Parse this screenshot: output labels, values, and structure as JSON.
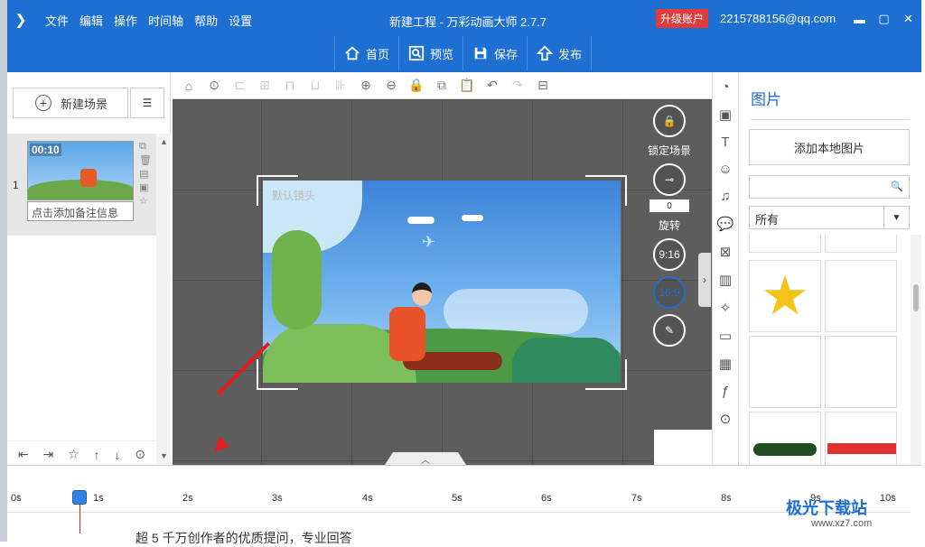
{
  "menu": [
    "文件",
    "编辑",
    "操作",
    "时间轴",
    "帮助",
    "设置"
  ],
  "window_title": "新建工程 - 万彩动画大师 2.7.7",
  "upgrade": "升级账户",
  "email": "2215788156@qq.com",
  "toolbar": [
    {
      "label": "首页",
      "icon": "home-icon"
    },
    {
      "label": "预览",
      "icon": "preview-icon"
    },
    {
      "label": "保存",
      "icon": "save-icon"
    },
    {
      "label": "发布",
      "icon": "publish-icon"
    }
  ],
  "left": {
    "new_scene": "新建场景",
    "scene_number": "1",
    "scene_time": "00:10",
    "scene_note": "点击添加备注信息"
  },
  "stage": {
    "camera_label": "默认镜头"
  },
  "controls": {
    "lock_label": "锁定场景",
    "rotate_value": "0",
    "rotate_label": "旋转",
    "ratio_916": "9:16",
    "ratio_169": "16:9"
  },
  "right": {
    "title": "图片",
    "add_local": "添加本地图片",
    "search_placeholder": "",
    "filter": "所有"
  },
  "timeline": {
    "ticks": [
      "0s",
      "1s",
      "2s",
      "3s",
      "4s",
      "5s",
      "6s",
      "7s",
      "8s",
      "9s",
      "10s"
    ]
  },
  "footer_text": "超 5 千万创作者的优质提问，专业回答",
  "watermark": "极光下载站",
  "watermark_url": "www.xz7.com",
  "colors": {
    "accent": "#1e6fd2",
    "upgrade": "#e03c3c",
    "canvas": "#5d5d5d",
    "playhead": "#2f84e0"
  }
}
